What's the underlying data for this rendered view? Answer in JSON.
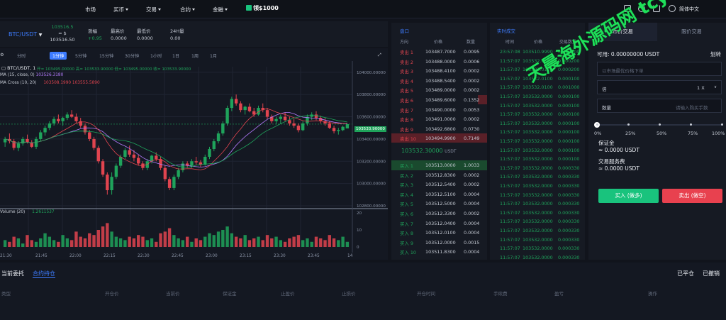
{
  "topbar": {
    "nav": [
      "市场",
      "买币",
      "交易",
      "合约",
      "金融"
    ],
    "gift": "领$1000",
    "lang": "简体中文"
  },
  "ticker": {
    "symbol": "BTC/USDT",
    "price_top": "103516.5",
    "price_eq": "≈ $",
    "price_bottom": "103516.50",
    "change_lbl": "涨幅",
    "change_val": "+0.95",
    "high_lbl": "最高价",
    "high_val": "0.0000",
    "low_lbl": "最低价",
    "low_val": "0.0000",
    "vol_lbl": "24H量",
    "vol_val": "0.00"
  },
  "chart": {
    "timeframes": [
      "分时",
      "1分钟",
      "5分钟",
      "15分钟",
      "30分钟",
      "1小时",
      "1日",
      "1周",
      "1月"
    ],
    "active_tf": "1分钟",
    "legend_title": "BTC/USDT, 1",
    "ohlc": "开= 103495.00000  高= 103533.90000  低= 103495.00000  收= 103533.90000",
    "ma_label": "MA (15, close, 0)",
    "ma_val": "103526.3180",
    "macross_label": "MA Cross (10, 20)",
    "macross_vals": "103508.1990  103555.5890",
    "y_ticks": [
      "104000.00000",
      "103800.00000",
      "103600.00000",
      "103533.90000",
      "103400.00000",
      "103200.00000",
      "103000.00000",
      "102800.00000"
    ],
    "x_ticks": [
      "21:30",
      "21:45",
      "22:00",
      "22:15",
      "22:30",
      "22:45",
      "23:00",
      "23:15",
      "23:30",
      "23:45",
      "14"
    ],
    "volume_label": "Volume (20)",
    "volume_val": "1.2611537",
    "vol_ticks": [
      "20",
      "10",
      "0"
    ],
    "current_price": "103533.90000"
  },
  "chart_data": {
    "type": "candlestick",
    "title": "BTC/USDT, 1",
    "ylim": [
      102800,
      104050
    ],
    "candles": [
      [
        103370,
        103420,
        103330,
        103400
      ],
      [
        103400,
        103450,
        103360,
        103380
      ],
      [
        103380,
        103400,
        103300,
        103320
      ],
      [
        103320,
        103380,
        103290,
        103360
      ],
      [
        103360,
        103420,
        103340,
        103400
      ],
      [
        103400,
        103440,
        103360,
        103370
      ],
      [
        103370,
        103390,
        103320,
        103330
      ],
      [
        103330,
        103420,
        103310,
        103400
      ],
      [
        103400,
        103480,
        103380,
        103460
      ],
      [
        103460,
        103520,
        103430,
        103500
      ],
      [
        103500,
        103560,
        103480,
        103540
      ],
      [
        103540,
        103600,
        103520,
        103580
      ],
      [
        103580,
        103620,
        103540,
        103560
      ],
      [
        103560,
        103600,
        103520,
        103590
      ],
      [
        103590,
        103640,
        103570,
        103620
      ],
      [
        103620,
        103660,
        103590,
        103600
      ],
      [
        103600,
        103630,
        103540,
        103560
      ],
      [
        103560,
        103590,
        103500,
        103520
      ],
      [
        103520,
        103540,
        103440,
        103460
      ],
      [
        103460,
        103480,
        103380,
        103400
      ],
      [
        103400,
        103420,
        103300,
        103320
      ],
      [
        103320,
        103340,
        103180,
        103200
      ],
      [
        103200,
        103220,
        103060,
        103080
      ],
      [
        103080,
        103100,
        102900,
        102940
      ],
      [
        102940,
        103100,
        102900,
        103060
      ],
      [
        103060,
        103180,
        103040,
        103160
      ],
      [
        103160,
        103260,
        103140,
        103240
      ],
      [
        103240,
        103320,
        103220,
        103300
      ],
      [
        103300,
        103340,
        103240,
        103260
      ],
      [
        103260,
        103300,
        103200,
        103230
      ],
      [
        103230,
        103260,
        103160,
        103180
      ],
      [
        103180,
        103200,
        103120,
        103140
      ],
      [
        103140,
        103220,
        103120,
        103200
      ],
      [
        103200,
        103260,
        103180,
        103250
      ],
      [
        103250,
        103280,
        103200,
        103220
      ],
      [
        103220,
        103240,
        103120,
        103140
      ],
      [
        103140,
        103160,
        103020,
        103040
      ],
      [
        103040,
        103060,
        102940,
        102960
      ],
      [
        102960,
        103080,
        102940,
        103060
      ],
      [
        103060,
        103140,
        103040,
        103120
      ],
      [
        103120,
        103200,
        103100,
        103180
      ],
      [
        103180,
        103200,
        103140,
        103160
      ],
      [
        103160,
        103220,
        103140,
        103200
      ],
      [
        103200,
        103240,
        103170,
        103190
      ],
      [
        103190,
        103210,
        103150,
        103170
      ],
      [
        103170,
        103260,
        103160,
        103240
      ],
      [
        103240,
        103330,
        103220,
        103310
      ],
      [
        103310,
        103400,
        103290,
        103380
      ],
      [
        103380,
        103470,
        103360,
        103450
      ],
      [
        103450,
        103560,
        103430,
        103540
      ],
      [
        103540,
        103700,
        103520,
        103680
      ],
      [
        103680,
        103780,
        103650,
        103760
      ],
      [
        103760,
        103800,
        103700,
        103720
      ],
      [
        103720,
        103740,
        103640,
        103660
      ],
      [
        103660,
        103700,
        103620,
        103690
      ],
      [
        103690,
        103720,
        103640,
        103650
      ],
      [
        103650,
        103680,
        103600,
        103620
      ],
      [
        103620,
        103700,
        103610,
        103680
      ],
      [
        103680,
        103720,
        103640,
        103660
      ],
      [
        103660,
        103680,
        103580,
        103600
      ],
      [
        103600,
        103620,
        103540,
        103560
      ],
      [
        103560,
        103600,
        103530,
        103580
      ],
      [
        103580,
        103620,
        103540,
        103600
      ],
      [
        103600,
        103640,
        103560,
        103570
      ],
      [
        103570,
        103600,
        103520,
        103540
      ],
      [
        103540,
        103580,
        103500,
        103520
      ],
      [
        103520,
        103540,
        103460,
        103480
      ],
      [
        103480,
        103560,
        103470,
        103540
      ],
      [
        103540,
        103620,
        103520,
        103600
      ],
      [
        103600,
        103640,
        103570,
        103620
      ],
      [
        103620,
        103650,
        103570,
        103590
      ],
      [
        103590,
        103610,
        103540,
        103560
      ],
      [
        103560,
        103590,
        103520,
        103540
      ],
      [
        103540,
        103560,
        103490,
        103500
      ],
      [
        103500,
        103520,
        103450,
        103470
      ],
      [
        103470,
        103500,
        103440,
        103480
      ],
      [
        103480,
        103520,
        103470,
        103510
      ],
      [
        103495,
        103534,
        103495,
        103534
      ]
    ],
    "volume": [
      4,
      3,
      6,
      5,
      2,
      7,
      4,
      3,
      5,
      8,
      6,
      4,
      3,
      7,
      5,
      4,
      9,
      6,
      5,
      8,
      7,
      10,
      12,
      14,
      9,
      6,
      5,
      4,
      6,
      5,
      7,
      6,
      4,
      5,
      3,
      8,
      9,
      11,
      7,
      5,
      4,
      6,
      3,
      5,
      4,
      6,
      8,
      7,
      9,
      10,
      12,
      8,
      6,
      5,
      7,
      4,
      5,
      6,
      4,
      7,
      5,
      6,
      4,
      3,
      5,
      6,
      7,
      4,
      5,
      3,
      6,
      5,
      4,
      7,
      5,
      4,
      6,
      3
    ],
    "x_labels": [
      "21:30",
      "21:45",
      "22:00",
      "22:15",
      "22:30",
      "22:45",
      "23:00",
      "23:15",
      "23:30",
      "23:45"
    ]
  },
  "orderbook": {
    "title": "盘口",
    "cols": [
      "方向",
      "价格",
      "数量"
    ],
    "asks": [
      {
        "side": "卖出 1",
        "price": "103487.7000",
        "qty": "0.0095"
      },
      {
        "side": "卖出 2",
        "price": "103488.0000",
        "qty": "0.0006"
      },
      {
        "side": "卖出 3",
        "price": "103488.4100",
        "qty": "0.0002"
      },
      {
        "side": "卖出 4",
        "price": "103488.5400",
        "qty": "0.0002"
      },
      {
        "side": "卖出 5",
        "price": "103489.0000",
        "qty": "0.0002"
      },
      {
        "side": "卖出 6",
        "price": "103489.6000",
        "qty": "0.1352"
      },
      {
        "side": "卖出 7",
        "price": "103490.0000",
        "qty": "0.0053"
      },
      {
        "side": "卖出 8",
        "price": "103491.0000",
        "qty": "0.0002"
      },
      {
        "side": "卖出 9",
        "price": "103492.6800",
        "qty": "0.0730"
      },
      {
        "side": "卖出 10",
        "price": "103494.9900",
        "qty": "0.7149"
      }
    ],
    "mid_price": "103532.30000",
    "mid_unit": "USDT",
    "bids": [
      {
        "side": "买入 1",
        "price": "103513.0000",
        "qty": "1.0033"
      },
      {
        "side": "买入 2",
        "price": "103512.8300",
        "qty": "0.0002"
      },
      {
        "side": "买入 3",
        "price": "103512.5400",
        "qty": "0.0002"
      },
      {
        "side": "买入 4",
        "price": "103512.5100",
        "qty": "0.0004"
      },
      {
        "side": "买入 5",
        "price": "103512.5000",
        "qty": "0.0004"
      },
      {
        "side": "买入 6",
        "price": "103512.3300",
        "qty": "0.0002"
      },
      {
        "side": "买入 7",
        "price": "103512.0400",
        "qty": "0.0004"
      },
      {
        "side": "买入 8",
        "price": "103512.0100",
        "qty": "0.0004"
      },
      {
        "side": "买入 9",
        "price": "103512.0000",
        "qty": "0.0015"
      },
      {
        "side": "买入 10",
        "price": "103511.8300",
        "qty": "0.0004"
      }
    ]
  },
  "trades": {
    "title": "实时成交",
    "cols": [
      "时间",
      "价格",
      "交易数量"
    ],
    "rows": [
      {
        "t": "23:57:08",
        "p": "103510.9990",
        "q": "0.628000"
      },
      {
        "t": "11:57:07",
        "p": "103532.0100",
        "q": "0.000200"
      },
      {
        "t": "11:57:07",
        "p": "103532.0100",
        "q": "0.000200"
      },
      {
        "t": "11:57:07",
        "p": "103532.0100",
        "q": "0.000100"
      },
      {
        "t": "11:57:07",
        "p": "103532.0100",
        "q": "0.001000"
      },
      {
        "t": "11:57:07",
        "p": "103532.0000",
        "q": "0.000100"
      },
      {
        "t": "11:57:07",
        "p": "103532.0000",
        "q": "0.000100"
      },
      {
        "t": "11:57:07",
        "p": "103532.0000",
        "q": "0.000100"
      },
      {
        "t": "11:57:07",
        "p": "103532.0000",
        "q": "0.000100"
      },
      {
        "t": "11:57:07",
        "p": "103532.0000",
        "q": "0.000100"
      },
      {
        "t": "11:57:07",
        "p": "103532.0000",
        "q": "0.000100"
      },
      {
        "t": "11:57:07",
        "p": "103532.0000",
        "q": "0.000100"
      },
      {
        "t": "11:57:07",
        "p": "103532.0000",
        "q": "0.000100"
      },
      {
        "t": "11:57:07",
        "p": "103532.0000",
        "q": "0.000330"
      },
      {
        "t": "11:57:07",
        "p": "103532.0000",
        "q": "0.000330"
      },
      {
        "t": "11:57:07",
        "p": "103532.0000",
        "q": "0.000330"
      },
      {
        "t": "11:57:07",
        "p": "103532.0000",
        "q": "0.000330"
      },
      {
        "t": "11:57:07",
        "p": "103532.0000",
        "q": "0.000330"
      },
      {
        "t": "11:57:07",
        "p": "103532.0000",
        "q": "0.000330"
      },
      {
        "t": "11:57:07",
        "p": "103532.0000",
        "q": "0.000330"
      },
      {
        "t": "11:57:07",
        "p": "103532.0000",
        "q": "0.000330"
      },
      {
        "t": "11:57:07",
        "p": "103532.0000",
        "q": "0.000330"
      },
      {
        "t": "11:57:07",
        "p": "103532.0000",
        "q": "0.000330"
      },
      {
        "t": "11:57:07",
        "p": "103532.0000",
        "q": "0.000330"
      },
      {
        "t": "11:57:07",
        "p": "103531.9500",
        "q": "0.001000"
      }
    ]
  },
  "orderform": {
    "tab_market": "市价交易",
    "tab_limit": "限价交易",
    "available": "可用: 0.00000000 USDT",
    "transfer": "划转",
    "price_placeholder": "以市场最优价格下单",
    "leverage_lbl": "倍",
    "leverage_val": "1 X",
    "qty_lbl": "数量",
    "qty_placeholder": "请输入购买手数",
    "slider_ticks": [
      "0%",
      "25%",
      "50%",
      "75%",
      "100%"
    ],
    "slider_value": 0,
    "margin_lbl": "保证金",
    "margin_val": "≈ 0.0000 USDT",
    "fee_lbl": "交易服务费",
    "fee_val": "≈ 0.0000 USDT",
    "buy_btn": "买入 (做多)",
    "sell_btn": "卖出 (做空)"
  },
  "bottom": {
    "tab_orders": "当前委托",
    "tab_positions": "合约持仓",
    "close_all": "已平仓",
    "cancelled": "已撤销",
    "cols": [
      "类型",
      "开仓价",
      "当前价",
      "保证金",
      "止盈价",
      "止损价",
      "开仓时间",
      "手续费",
      "盈亏",
      "操作"
    ]
  },
  "colors": {
    "up": "#1fa35b",
    "down": "#e0444f",
    "accent": "#3d7cff"
  },
  "watermark": "天晨海外源码网 tcym.cc"
}
